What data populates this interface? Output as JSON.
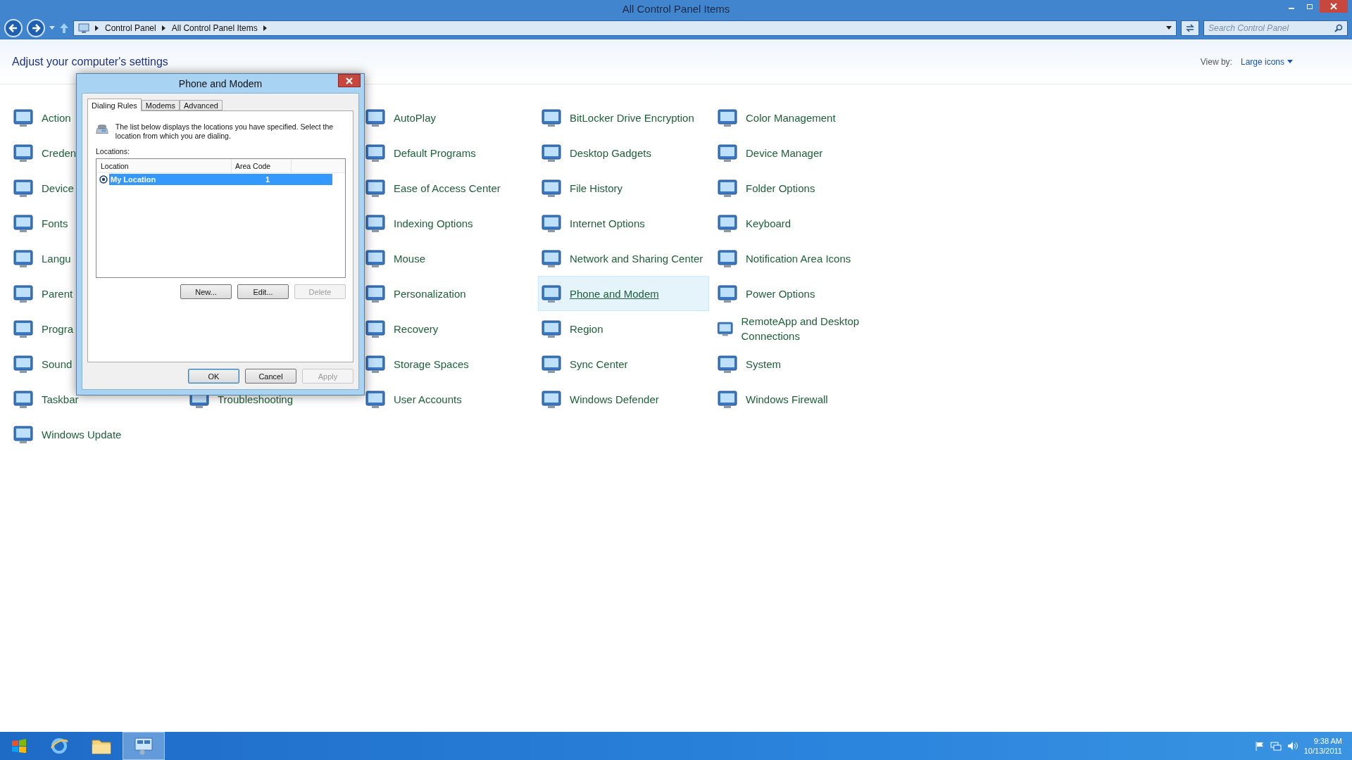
{
  "window": {
    "title": "All Control Panel Items"
  },
  "breadcrumb": [
    "Control Panel",
    "All Control Panel Items"
  ],
  "search": {
    "placeholder": "Search Control Panel"
  },
  "heading": "Adjust your computer's settings",
  "view_by": {
    "label": "View by:",
    "value": "Large icons"
  },
  "columns": [
    [
      {
        "label": "Action",
        "selected": false
      },
      {
        "label": "Creden",
        "selected": false
      },
      {
        "label": "Device",
        "selected": false
      },
      {
        "label": "Fonts",
        "selected": false
      },
      {
        "label": "Langu",
        "selected": false
      },
      {
        "label": "Parent",
        "selected": false
      },
      {
        "label": "Progra",
        "selected": false
      },
      {
        "label": "Sound",
        "selected": false
      },
      {
        "label": "Taskbar",
        "selected": false
      },
      {
        "label": "Windows Update",
        "selected": false
      }
    ],
    [
      {
        "label": "Troubleshooting",
        "selected": false
      }
    ],
    [
      {
        "label": "AutoPlay",
        "selected": false
      },
      {
        "label": "Default Programs",
        "selected": false
      },
      {
        "label": "Ease of Access Center",
        "selected": false
      },
      {
        "label": "Indexing Options",
        "selected": false
      },
      {
        "label": "Mouse",
        "selected": false
      },
      {
        "label": "Personalization",
        "selected": false
      },
      {
        "label": "Recovery",
        "selected": false
      },
      {
        "label": "Storage Spaces",
        "selected": false
      },
      {
        "label": "User Accounts",
        "selected": false
      }
    ],
    [
      {
        "label": "BitLocker Drive Encryption",
        "selected": false
      },
      {
        "label": "Desktop Gadgets",
        "selected": false
      },
      {
        "label": "File History",
        "selected": false
      },
      {
        "label": "Internet Options",
        "selected": false
      },
      {
        "label": "Network and Sharing Center",
        "selected": false
      },
      {
        "label": "Phone and Modem",
        "selected": true
      },
      {
        "label": "Region",
        "selected": false
      },
      {
        "label": "Sync Center",
        "selected": false
      },
      {
        "label": "Windows Defender",
        "selected": false
      }
    ],
    [
      {
        "label": "Color Management",
        "selected": false
      },
      {
        "label": "Device Manager",
        "selected": false
      },
      {
        "label": "Folder Options",
        "selected": false
      },
      {
        "label": "Keyboard",
        "selected": false
      },
      {
        "label": "Notification Area Icons",
        "selected": false
      },
      {
        "label": "Power Options",
        "selected": false
      },
      {
        "label": "RemoteApp and Desktop Connections",
        "selected": false
      },
      {
        "label": "System",
        "selected": false
      },
      {
        "label": "Windows Firewall",
        "selected": false
      }
    ]
  ],
  "dialog": {
    "title": "Phone and Modem",
    "tabs": [
      {
        "label": "Dialing Rules",
        "selected": true
      },
      {
        "label": "Modems",
        "selected": false
      },
      {
        "label": "Advanced",
        "selected": false
      }
    ],
    "description": "The list below displays the locations you have specified. Select the location from which you are dialing.",
    "locations_label": "Locations:",
    "list_columns": [
      "Location",
      "Area Code"
    ],
    "rows": [
      {
        "location": "My Location",
        "area_code": "1",
        "selected": true,
        "default": true
      }
    ],
    "list_buttons": [
      {
        "label": "New...",
        "disabled": false
      },
      {
        "label": "Edit...",
        "disabled": false
      },
      {
        "label": "Delete",
        "disabled": true
      }
    ],
    "buttons": [
      {
        "label": "OK",
        "disabled": false,
        "default": true
      },
      {
        "label": "Cancel",
        "disabled": false,
        "default": false
      },
      {
        "label": "Apply",
        "disabled": true,
        "default": false
      }
    ]
  },
  "taskbar": {
    "apps": [
      {
        "kind": "browser",
        "selected": false
      },
      {
        "kind": "folder",
        "selected": false
      },
      {
        "kind": "control-panel",
        "selected": true
      }
    ],
    "clock": {
      "time": "9:38 AM",
      "date": "10/13/2011"
    }
  }
}
